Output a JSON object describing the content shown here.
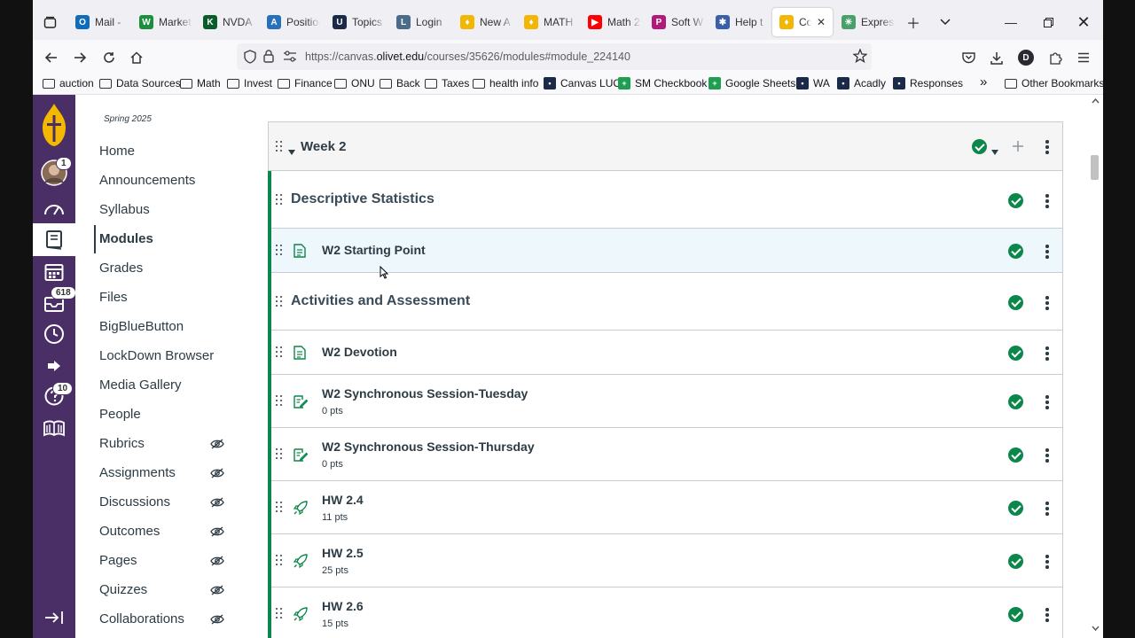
{
  "browser": {
    "tabs": [
      {
        "title": "Mail -",
        "icon": "outlook-icon",
        "color": "#0f6cbd",
        "letter": "O"
      },
      {
        "title": "Market",
        "icon": "wix-icon",
        "color": "#1a8f3c",
        "letter": "W"
      },
      {
        "title": "NVDA",
        "icon": "stock-icon",
        "color": "#0a5c2a",
        "letter": "K"
      },
      {
        "title": "Position",
        "icon": "amex-icon",
        "color": "#2671b9",
        "letter": "A"
      },
      {
        "title": "Topics",
        "icon": "topics-icon",
        "color": "#1c2a49",
        "letter": "U"
      },
      {
        "title": "Login",
        "icon": "shield-login-icon",
        "color": "#4a6b8a",
        "letter": "L"
      },
      {
        "title": "New A",
        "icon": "flame-icon",
        "color": "#f2b705",
        "letter": "♦"
      },
      {
        "title": "MATH",
        "icon": "flame-icon",
        "color": "#f2b705",
        "letter": "♦"
      },
      {
        "title": "Math 2",
        "icon": "youtube-icon",
        "color": "#ff0000",
        "letter": "▶"
      },
      {
        "title": "Soft W",
        "icon": "paypal-icon",
        "color": "#b01a7a",
        "letter": "P"
      },
      {
        "title": "Help t",
        "icon": "help-icon",
        "color": "#3a5fa8",
        "letter": "✱"
      },
      {
        "title": "Cou",
        "icon": "flame-icon",
        "color": "#f2b705",
        "letter": "♦"
      },
      {
        "title": "Expres",
        "icon": "express-icon",
        "color": "#49a06b",
        "letter": "✳"
      }
    ],
    "url_prefix": "https://canvas.",
    "url_domain": "olivet.edu",
    "url_path": "/courses/35626/modules#module_224140",
    "profile_letter": "D",
    "bookmarks": [
      {
        "label": "auction",
        "type": "folder"
      },
      {
        "label": "Data Sources",
        "type": "folder"
      },
      {
        "label": "Math",
        "type": "folder"
      },
      {
        "label": "Invest",
        "type": "folder"
      },
      {
        "label": "Finance",
        "type": "folder"
      },
      {
        "label": "ONU",
        "type": "folder"
      },
      {
        "label": "Back",
        "type": "folder"
      },
      {
        "label": "Taxes",
        "type": "folder"
      },
      {
        "label": "health info",
        "type": "folder"
      },
      {
        "label": "Canvas LUO",
        "type": "site"
      },
      {
        "label": "SM Checkbook",
        "type": "sheets"
      },
      {
        "label": "Google Sheets",
        "type": "sheets"
      },
      {
        "label": "WA",
        "type": "site"
      },
      {
        "label": "Acadly",
        "type": "site"
      },
      {
        "label": "Responses",
        "type": "site"
      }
    ],
    "other_bookmarks": "Other Bookmarks"
  },
  "global_nav": {
    "account_badge": "1",
    "inbox_badge": "618",
    "help_badge": "10"
  },
  "course_nav": {
    "term": "Spring 2025",
    "links": [
      {
        "label": "Home",
        "hidden": false
      },
      {
        "label": "Announcements",
        "hidden": false
      },
      {
        "label": "Syllabus",
        "hidden": false
      },
      {
        "label": "Modules",
        "hidden": false,
        "active": true
      },
      {
        "label": "Grades",
        "hidden": false
      },
      {
        "label": "Files",
        "hidden": false
      },
      {
        "label": "BigBlueButton",
        "hidden": false
      },
      {
        "label": "LockDown Browser",
        "hidden": false
      },
      {
        "label": "Media Gallery",
        "hidden": false
      },
      {
        "label": "People",
        "hidden": false
      },
      {
        "label": "Rubrics",
        "hidden": true
      },
      {
        "label": "Assignments",
        "hidden": true
      },
      {
        "label": "Discussions",
        "hidden": true
      },
      {
        "label": "Outcomes",
        "hidden": true
      },
      {
        "label": "Pages",
        "hidden": true
      },
      {
        "label": "Quizzes",
        "hidden": true
      },
      {
        "label": "Collaborations",
        "hidden": true
      }
    ]
  },
  "module": {
    "title": "Week 2",
    "items": [
      {
        "kind": "header",
        "title": "Descriptive Statistics"
      },
      {
        "kind": "page",
        "title": "W2 Starting Point",
        "highlight": true
      },
      {
        "kind": "header",
        "title": "Activities and Assessment"
      },
      {
        "kind": "page",
        "title": "W2 Devotion"
      },
      {
        "kind": "assignment",
        "title": "W2 Synchronous Session-Tuesday",
        "points": "0 pts"
      },
      {
        "kind": "assignment",
        "title": "W2 Synchronous Session-Thursday",
        "points": "0 pts"
      },
      {
        "kind": "quiz",
        "title": "HW 2.4",
        "points": "11 pts"
      },
      {
        "kind": "quiz",
        "title": "HW 2.5",
        "points": "25 pts"
      },
      {
        "kind": "quiz",
        "title": "HW 2.6",
        "points": "15 pts"
      }
    ]
  },
  "colors": {
    "canvas_purple": "#4a2f66",
    "published_green": "#0b874b",
    "text_dark": "#2d3b45"
  }
}
